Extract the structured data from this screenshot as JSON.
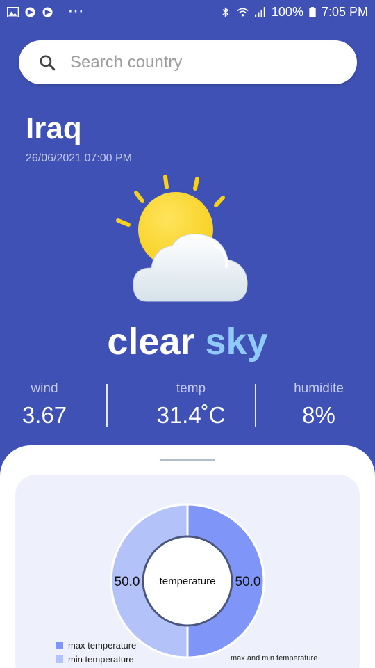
{
  "status_bar": {
    "battery": "100%",
    "time": "7:05 PM",
    "left_icons": [
      "gallery-icon",
      "play-icon",
      "play-icon"
    ],
    "right_icons": [
      "bluetooth-icon",
      "wifi-icon",
      "signal-icon",
      "battery-icon"
    ]
  },
  "search": {
    "placeholder": "Search country",
    "value": ""
  },
  "location": {
    "country": "Iraq",
    "datetime": "26/06/2021 07:00 PM"
  },
  "weather": {
    "icon": "partly-cloudy-icon",
    "condition_word_1": "clear",
    "condition_word_2": "sky"
  },
  "stats": {
    "wind_label": "wind",
    "wind_value": "3.67",
    "temp_label": "temp",
    "temp_value": "31.4˚C",
    "humidity_label": "humidite",
    "humidity_value": "8%"
  },
  "colors": {
    "background": "#3f51b5",
    "accent_sky": "#90caf9",
    "max_temp": "#7f95f7",
    "min_temp": "#b3c2f8"
  },
  "chart_data": {
    "type": "pie",
    "center_label": "temperature",
    "caption": "max and min temperature",
    "slices": [
      {
        "name": "max temperature",
        "value": 50.0,
        "label": "50.0",
        "color": "#7f95f7"
      },
      {
        "name": "min temperature",
        "value": 50.0,
        "label": "50.0",
        "color": "#b3c2f8"
      }
    ],
    "legend_position": "bottom-left"
  }
}
